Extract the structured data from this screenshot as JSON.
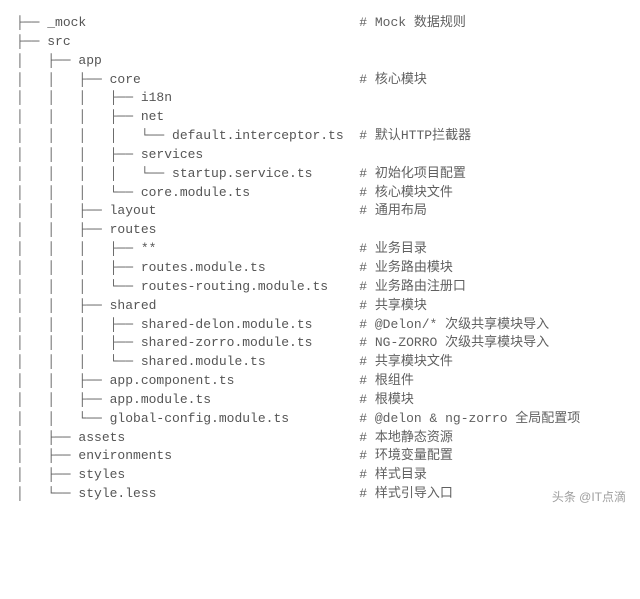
{
  "rows": [
    {
      "prefix": "├── ",
      "name": "_mock",
      "pad": 35,
      "comment": "# Mock 数据规则"
    },
    {
      "prefix": "├── ",
      "name": "src",
      "pad": 0,
      "comment": ""
    },
    {
      "prefix": "│   ├── ",
      "name": "app",
      "pad": 0,
      "comment": ""
    },
    {
      "prefix": "│   │   ├── ",
      "name": "core",
      "pad": 28,
      "comment": "# 核心模块"
    },
    {
      "prefix": "│   │   │   ├── ",
      "name": "i18n",
      "pad": 0,
      "comment": ""
    },
    {
      "prefix": "│   │   │   ├── ",
      "name": "net",
      "pad": 0,
      "comment": ""
    },
    {
      "prefix": "│   │   │   │   └── ",
      "name": "default.interceptor.ts",
      "pad": 2,
      "comment": "# 默认HTTP拦截器"
    },
    {
      "prefix": "│   │   │   ├── ",
      "name": "services",
      "pad": 0,
      "comment": ""
    },
    {
      "prefix": "│   │   │   │   └── ",
      "name": "startup.service.ts",
      "pad": 6,
      "comment": "# 初始化项目配置"
    },
    {
      "prefix": "│   │   │   └── ",
      "name": "core.module.ts",
      "pad": 14,
      "comment": "# 核心模块文件"
    },
    {
      "prefix": "│   │   ├── ",
      "name": "layout",
      "pad": 26,
      "comment": "# 通用布局"
    },
    {
      "prefix": "│   │   ├── ",
      "name": "routes",
      "pad": 0,
      "comment": ""
    },
    {
      "prefix": "│   │   │   ├── ",
      "name": "**",
      "pad": 26,
      "comment": "# 业务目录"
    },
    {
      "prefix": "│   │   │   ├── ",
      "name": "routes.module.ts",
      "pad": 12,
      "comment": "# 业务路由模块"
    },
    {
      "prefix": "│   │   │   └── ",
      "name": "routes-routing.module.ts",
      "pad": 4,
      "comment": "# 业务路由注册口"
    },
    {
      "prefix": "│   │   ├── ",
      "name": "shared",
      "pad": 26,
      "comment": "# 共享模块"
    },
    {
      "prefix": "│   │   │   ├── ",
      "name": "shared-delon.module.ts",
      "pad": 6,
      "comment": "# @Delon/* 次级共享模块导入"
    },
    {
      "prefix": "│   │   │   ├── ",
      "name": "shared-zorro.module.ts",
      "pad": 6,
      "comment": "# NG-ZORRO 次级共享模块导入"
    },
    {
      "prefix": "│   │   │   └── ",
      "name": "shared.module.ts",
      "pad": 12,
      "comment": "# 共享模块文件"
    },
    {
      "prefix": "│   │   ├── ",
      "name": "app.component.ts",
      "pad": 16,
      "comment": "# 根组件"
    },
    {
      "prefix": "│   │   ├── ",
      "name": "app.module.ts",
      "pad": 19,
      "comment": "# 根模块"
    },
    {
      "prefix": "│   │   └── ",
      "name": "global-config.module.ts",
      "pad": 9,
      "comment": "# @delon & ng-zorro 全局配置项"
    },
    {
      "prefix": "│   ├── ",
      "name": "assets",
      "pad": 30,
      "comment": "# 本地静态资源"
    },
    {
      "prefix": "│   ├── ",
      "name": "environments",
      "pad": 24,
      "comment": "# 环境变量配置"
    },
    {
      "prefix": "│   ├── ",
      "name": "styles",
      "pad": 30,
      "comment": "# 样式目录"
    },
    {
      "prefix": "│   └── ",
      "name": "style.less",
      "pad": 26,
      "comment": "# 样式引导入口"
    }
  ],
  "watermark": "头条 @IT点滴"
}
